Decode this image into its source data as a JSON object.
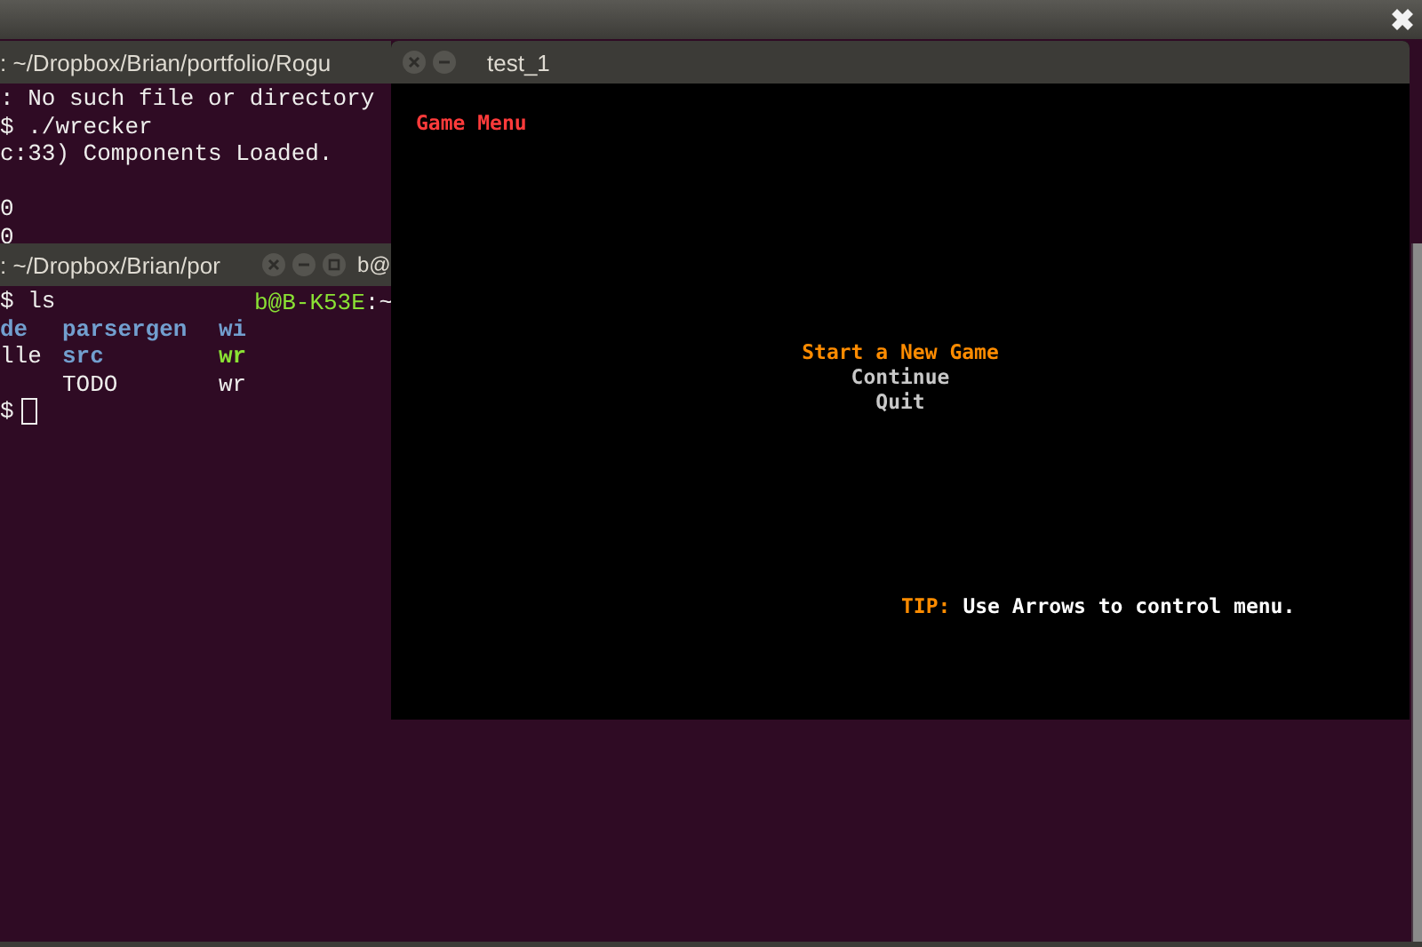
{
  "terminal_back": {
    "title": ": ~/Dropbox/Brian/portfolio/Rogu",
    "lines": [
      {
        "text": ": No such file or directory",
        "gap_before": false
      },
      {
        "text": "$ ./wrecker",
        "gap_before": false
      },
      {
        "text": "c:33) Components Loaded.",
        "gap_before": false
      },
      {
        "text": "0",
        "gap_before": true
      },
      {
        "text": "0",
        "gap_before": false
      }
    ]
  },
  "terminal_middle": {
    "title": ": ~/Dropbox/Brian/por",
    "command": "$ ls",
    "listing": [
      [
        {
          "text": "de",
          "kind": "directory"
        },
        {
          "text": "parsergen",
          "kind": "directory"
        },
        {
          "text": "wi",
          "kind": "directory"
        }
      ],
      [
        {
          "text": "lle",
          "kind": "file"
        },
        {
          "text": "src",
          "kind": "directory"
        },
        {
          "text": "wr",
          "kind": "executable"
        }
      ],
      [
        {
          "kind": "file"
        },
        {
          "text": "TODO",
          "kind": "file"
        },
        {
          "text": "wr",
          "kind": "file"
        }
      ]
    ],
    "prompt": "$"
  },
  "terminal_front": {
    "title": "b@",
    "user_host": "b@B-K53E",
    "path": ":~"
  },
  "game": {
    "title": "test_1",
    "heading": "Game Menu",
    "menu": [
      {
        "label": "Start a New Game",
        "selected": true
      },
      {
        "label": "Continue",
        "selected": false
      },
      {
        "label": "Quit",
        "selected": false
      }
    ],
    "tip_label": "TIP:",
    "tip_text": "Use Arrows to control menu."
  }
}
